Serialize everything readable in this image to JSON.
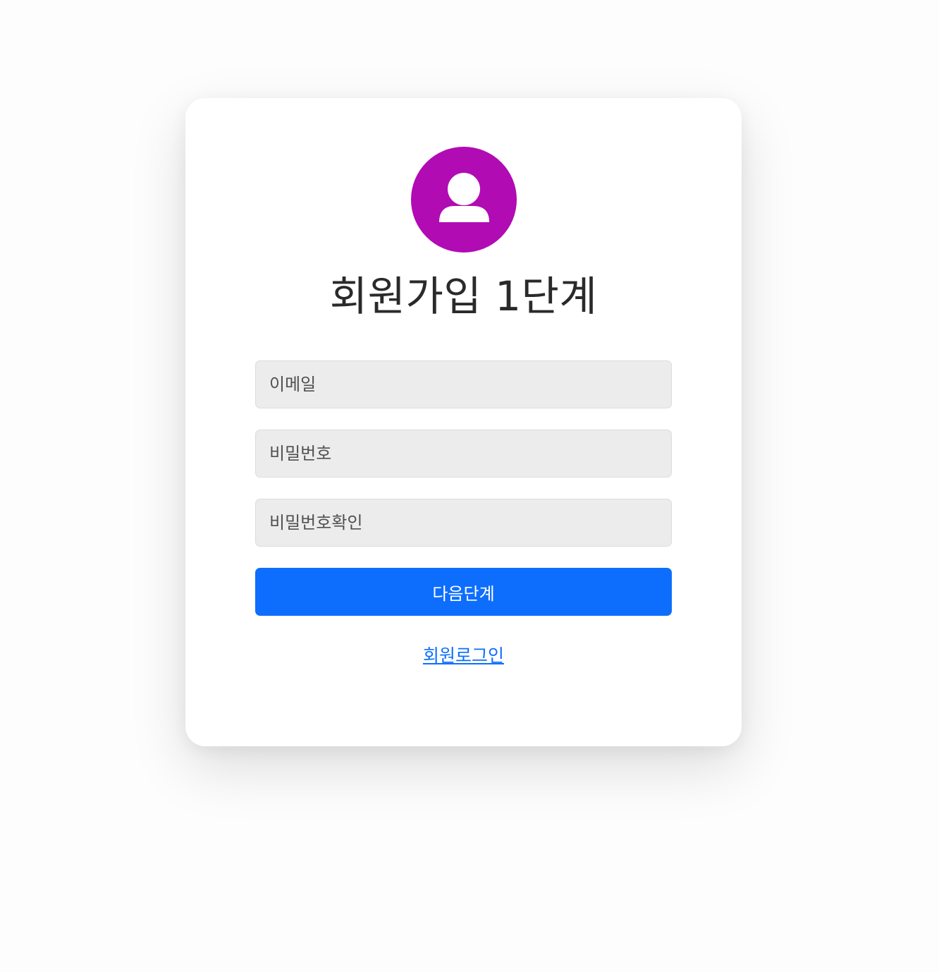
{
  "header": {
    "avatar_icon": "user-icon",
    "avatar_color": "#b10bb4",
    "title": "회원가입 1단계"
  },
  "form": {
    "email": {
      "placeholder": "이메일",
      "value": ""
    },
    "password": {
      "placeholder": "비밀번호",
      "value": ""
    },
    "password_confirm": {
      "placeholder": "비밀번호확인",
      "value": ""
    },
    "next_label": "다음단계",
    "next_color": "#0d6efd"
  },
  "footer": {
    "login_link_label": "회원로그인"
  }
}
